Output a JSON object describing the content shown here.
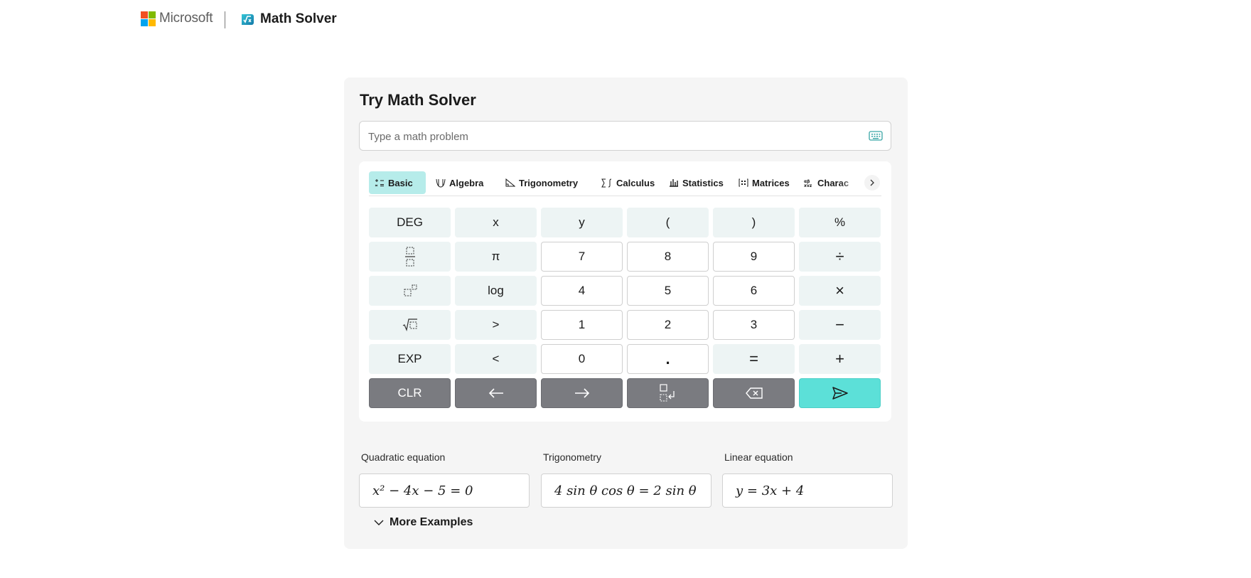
{
  "header": {
    "brand": "Microsoft",
    "app_name": "Math Solver",
    "logo_colors": [
      "#f25022",
      "#7fba00",
      "#00a4ef",
      "#ffb900"
    ]
  },
  "card": {
    "title": "Try Math Solver",
    "input": {
      "value": "",
      "placeholder": "Type a math problem"
    }
  },
  "tabs": [
    {
      "label": "Basic",
      "icon": "basic-ops-icon",
      "active": true
    },
    {
      "label": "Algebra",
      "icon": "algebra-icon",
      "active": false
    },
    {
      "label": "Trigonometry",
      "icon": "triangle-icon",
      "active": false
    },
    {
      "label": "Calculus",
      "icon": "sigma-integral-icon",
      "active": false
    },
    {
      "label": "Statistics",
      "icon": "bar-chart-icon",
      "active": false
    },
    {
      "label": "Matrices",
      "icon": "matrix-icon",
      "active": false
    },
    {
      "label": "Charac",
      "icon": "characters-icon",
      "active": false
    }
  ],
  "keys": {
    "row1": [
      "DEG",
      "x",
      "y",
      "(",
      ")",
      "%"
    ],
    "row2": [
      "",
      "π",
      "7",
      "8",
      "9",
      "÷"
    ],
    "row3": [
      "",
      "log",
      "4",
      "5",
      "6",
      "×"
    ],
    "row4": [
      "",
      ">",
      "1",
      "2",
      "3",
      "−"
    ],
    "row5": [
      "EXP",
      "<",
      "0",
      ".",
      "=",
      "+"
    ],
    "row6": [
      "CLR",
      "",
      "",
      "",
      "",
      ""
    ]
  },
  "examples": [
    {
      "label": "Quadratic equation",
      "expr_html": "x² − 4x − 5 = 0"
    },
    {
      "label": "Trigonometry",
      "expr_html": "4 sin θ cos θ = 2 sin θ"
    },
    {
      "label": "Linear equation",
      "expr_html": "y = 3x + 4"
    }
  ],
  "more_examples": "More Examples",
  "colors": {
    "accent": "#5ce0d8",
    "tab_active": "#b6ecea",
    "dark_key": "#7a7b80"
  }
}
